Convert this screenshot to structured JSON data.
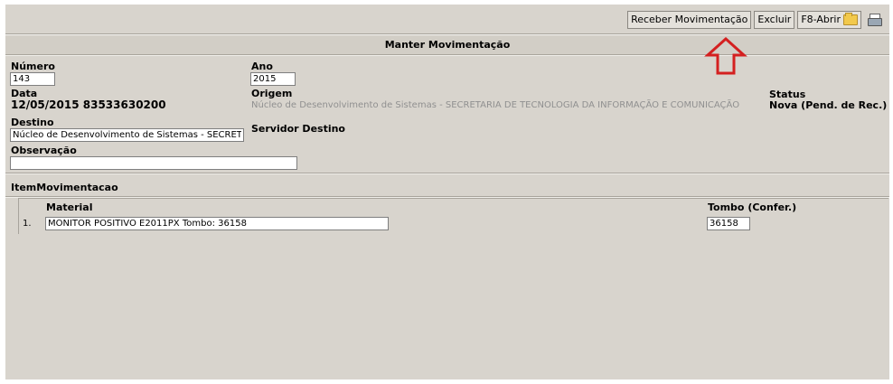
{
  "toolbar": {
    "receber_label": "Receber Movimentação",
    "excluir_label": "Excluir",
    "abrir_label": "F8-Abrir"
  },
  "form": {
    "title": "Manter Movimentação",
    "numero_label": "Número",
    "numero_value": "143",
    "ano_label": "Ano",
    "ano_value": "2015",
    "data_label": "Data",
    "data_value": "12/05/2015  83533630200",
    "origem_label": "Origem",
    "origem_value": "Núcleo de Desenvolvimento de Sistemas - SECRETARIA DE TECNOLOGIA DA INFORMAÇÃO E COMUNICAÇÃO",
    "status_label": "Status",
    "status_value": "Nova (Pend. de Rec.)",
    "destino_label": "Destino",
    "destino_value": "Núcleo de Desenvolvimento de Sistemas - SECRETARIA",
    "servidor_destino_label": "Servidor Destino",
    "observacao_label": "Observação",
    "observacao_value": ""
  },
  "items": {
    "title": "ItemMovimentacao",
    "col_material": "Material",
    "col_tombo": "Tombo (Confer.)",
    "rows": [
      {
        "index": "1.",
        "material": "MONITOR POSITIVO E2011PX Tombo: 36158",
        "tombo": "36158"
      }
    ]
  },
  "colors": {
    "panel_bg": "#d8d4cd",
    "arrow": "#d42020"
  }
}
